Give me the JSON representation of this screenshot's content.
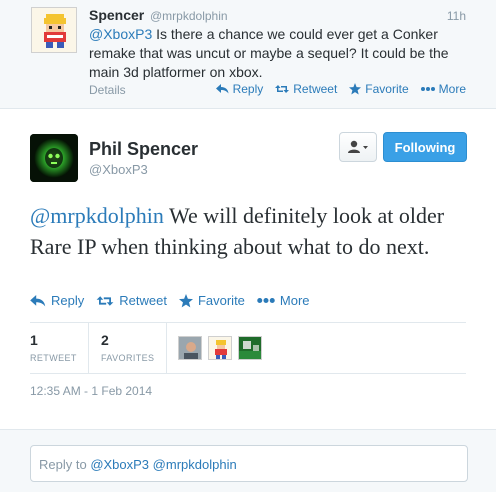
{
  "reply_tweet": {
    "name": "Spencer",
    "handle": "@mrpkdolphin",
    "time": "11h",
    "mention": "@XboxP3",
    "text": " Is there a chance we could ever get a Conker remake that was uncut or maybe a sequel? It could be the main 3d platformer on xbox.",
    "details_label": "Details",
    "actions": {
      "reply": "Reply",
      "retweet": "Retweet",
      "favorite": "Favorite",
      "more": "More"
    }
  },
  "main_tweet": {
    "name": "Phil Spencer",
    "handle": "@XboxP3",
    "follow_label": "Following",
    "mention": "@mrpkdolphin",
    "text": " We will definitely look at older Rare IP when thinking about what to do next.",
    "actions": {
      "reply": "Reply",
      "retweet": "Retweet",
      "favorite": "Favorite",
      "more": "More"
    },
    "stats": {
      "retweets": "1",
      "retweets_label": "RETWEET",
      "favorites": "2",
      "favorites_label": "FAVORITES"
    },
    "timestamp": "12:35 AM - 1 Feb 2014"
  },
  "reply_box": {
    "prefix": "Reply to ",
    "mention1": "@XboxP3",
    "mention2": "@mrpkdolphin"
  },
  "colors": {
    "link": "#2b7bb9",
    "follow_button": "#3aa0e6",
    "muted": "#8899a6"
  }
}
